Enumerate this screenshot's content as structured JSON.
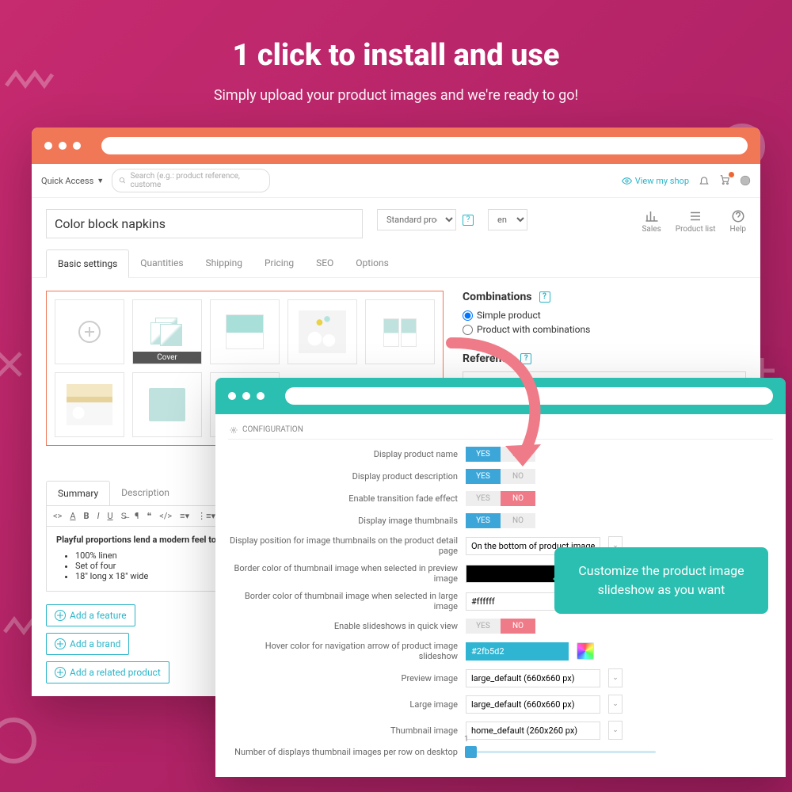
{
  "hero": {
    "title": "1 click to install and use",
    "subtitle": "Simply upload your product images and we're ready to go!"
  },
  "topbar": {
    "quick_access": "Quick Access",
    "search_placeholder": "Search (e.g.: product reference, custome",
    "view_shop": "View my shop"
  },
  "head": {
    "product_name": "Color block napkins",
    "type": "Standard produ",
    "lang": "en",
    "mini": {
      "sales": "Sales",
      "product_list": "Product list",
      "help": "Help"
    }
  },
  "tabs": [
    "Basic settings",
    "Quantities",
    "Shipping",
    "Pricing",
    "SEO",
    "Options"
  ],
  "gallery": {
    "cover": "Cover"
  },
  "side": {
    "combinations": "Combinations",
    "simple": "Simple product",
    "combo": "Product with combinations",
    "reference": "Reference"
  },
  "editor": {
    "tabs": {
      "summary": "Summary",
      "description": "Description"
    },
    "text": "Playful proportions lend a modern feel to the sophisticated Co",
    "bullets": [
      "100% linen",
      "Set of four",
      "18\" long x 18\" wide"
    ]
  },
  "addbtns": {
    "feature": "Add a feature",
    "brand": "Add a brand",
    "related": "Add a related product"
  },
  "config": {
    "title": "CONFIGURATION",
    "rows": {
      "name": "Display product name",
      "desc": "Display product description",
      "fade": "Enable transition fade effect",
      "thumbs": "Display image thumbnails",
      "position": "Display position for image thumbnails on the product detail page",
      "position_val": "On the bottom of product image",
      "bcolor_preview": "Border color of thumbnail image when selected in preview image",
      "bcolor_large": "Border color of thumbnail image when selected in large image",
      "bcolor_large_val": "#ffffff",
      "quickview": "Enable slideshows in quick view",
      "hover": "Hover color for navigation arrow of product image slideshow",
      "hover_val": "#2fb5d2",
      "preview": "Preview image",
      "preview_val": "large_default (660x660 px)",
      "large": "Large image",
      "large_val": "large_default (660x660 px)",
      "thumb": "Thumbnail image",
      "thumb_val": "home_default (260x260 px)",
      "perrow": "Number of displays thumbnail images per row on desktop"
    },
    "yes": "YES",
    "no": "NO"
  },
  "tooltip": "Customize the product image slideshow as you want"
}
